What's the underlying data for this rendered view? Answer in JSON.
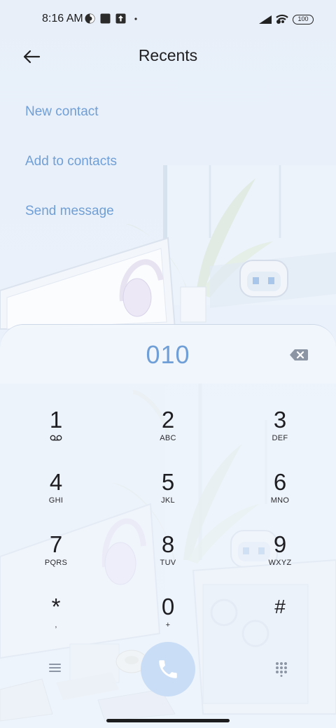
{
  "status_bar": {
    "time": "8:16 AM",
    "battery": "100",
    "icons": [
      "vpn-icon",
      "notification-square-icon",
      "upload-icon",
      "dot-icon",
      "signal-icon",
      "wifi-icon",
      "battery-icon"
    ]
  },
  "header": {
    "title": "Recents",
    "back_icon": "back-arrow-icon"
  },
  "actions": [
    {
      "label": "New contact"
    },
    {
      "label": "Add to contacts"
    },
    {
      "label": "Send message"
    }
  ],
  "dialer": {
    "number": "010",
    "backspace_icon": "backspace-icon",
    "keys": [
      {
        "digit": "1",
        "letters": "",
        "icon": "voicemail-icon"
      },
      {
        "digit": "2",
        "letters": "ABC"
      },
      {
        "digit": "3",
        "letters": "DEF"
      },
      {
        "digit": "4",
        "letters": "GHI"
      },
      {
        "digit": "5",
        "letters": "JKL"
      },
      {
        "digit": "6",
        "letters": "MNO"
      },
      {
        "digit": "7",
        "letters": "PQRS"
      },
      {
        "digit": "8",
        "letters": "TUV"
      },
      {
        "digit": "9",
        "letters": "WXYZ"
      },
      {
        "digit": "*",
        "letters": ","
      },
      {
        "digit": "0",
        "letters": "+"
      },
      {
        "digit": "#",
        "letters": ""
      }
    ],
    "bottom_icons": [
      "menu-icon",
      "phone-icon",
      "keypad-grid-icon"
    ]
  },
  "colors": {
    "accent": "#6f9fd6",
    "call_button": "#c9ddf6",
    "background": "#e9f0f9"
  }
}
